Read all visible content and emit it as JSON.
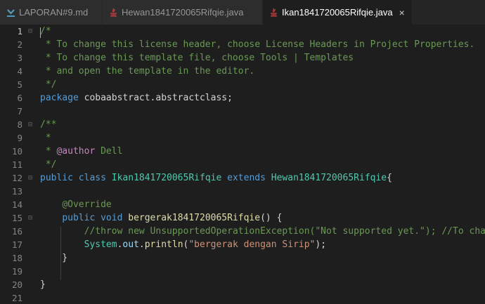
{
  "tabs": [
    {
      "label": "LAPORAN#9.md",
      "icon": "markdown-icon",
      "active": false
    },
    {
      "label": "Hewan1841720065Rifqie.java",
      "icon": "java-icon",
      "active": false
    },
    {
      "label": "Ikan1841720065Rifqie.java",
      "icon": "java-icon",
      "active": true
    }
  ],
  "close_glyph": "×",
  "gutter": {
    "current_line": 1,
    "fold_glyph": "⊟",
    "folds": [
      1,
      8,
      12,
      15
    ]
  },
  "lines": [
    {
      "n": "1",
      "tokens": [
        {
          "t": "/*",
          "c": "cm"
        }
      ]
    },
    {
      "n": "2",
      "tokens": [
        {
          "t": " * To change this license header, choose License Headers in Project Properties.",
          "c": "cm"
        }
      ]
    },
    {
      "n": "3",
      "tokens": [
        {
          "t": " * To change this template file, choose Tools | Templates",
          "c": "cm"
        }
      ]
    },
    {
      "n": "4",
      "tokens": [
        {
          "t": " * and open the template in the editor.",
          "c": "cm"
        }
      ]
    },
    {
      "n": "5",
      "tokens": [
        {
          "t": " */",
          "c": "cm"
        }
      ]
    },
    {
      "n": "6",
      "tokens": [
        {
          "t": "package",
          "c": "kw"
        },
        {
          "t": " cobaabstract.abstractclass;",
          "c": "tx"
        }
      ]
    },
    {
      "n": "7",
      "tokens": []
    },
    {
      "n": "8",
      "tokens": [
        {
          "t": "/**",
          "c": "cm"
        }
      ]
    },
    {
      "n": "9",
      "tokens": [
        {
          "t": " *",
          "c": "cm"
        }
      ]
    },
    {
      "n": "10",
      "tokens": [
        {
          "t": " * ",
          "c": "cm"
        },
        {
          "t": "@author",
          "c": "an"
        },
        {
          "t": " Dell",
          "c": "cm"
        }
      ]
    },
    {
      "n": "11",
      "tokens": [
        {
          "t": " */",
          "c": "cm"
        }
      ]
    },
    {
      "n": "12",
      "tokens": [
        {
          "t": "public",
          "c": "kw"
        },
        {
          "t": " ",
          "c": "tx"
        },
        {
          "t": "class",
          "c": "kw"
        },
        {
          "t": " ",
          "c": "tx"
        },
        {
          "t": "Ikan1841720065Rifqie",
          "c": "ty"
        },
        {
          "t": " ",
          "c": "tx"
        },
        {
          "t": "extends",
          "c": "kw"
        },
        {
          "t": " ",
          "c": "tx"
        },
        {
          "t": "Hewan1841720065Rifqie",
          "c": "ty"
        },
        {
          "t": "{",
          "c": "tx"
        }
      ]
    },
    {
      "n": "13",
      "tokens": []
    },
    {
      "n": "14",
      "tokens": [
        {
          "t": "    ",
          "c": "tx"
        },
        {
          "t": "@Override",
          "c": "cm"
        }
      ]
    },
    {
      "n": "15",
      "tokens": [
        {
          "t": "    ",
          "c": "tx"
        },
        {
          "t": "public",
          "c": "kw"
        },
        {
          "t": " ",
          "c": "tx"
        },
        {
          "t": "void",
          "c": "kw"
        },
        {
          "t": " ",
          "c": "tx"
        },
        {
          "t": "bergerak1841720065Rifqie",
          "c": "fn"
        },
        {
          "t": "() {",
          "c": "tx"
        }
      ]
    },
    {
      "n": "16",
      "tokens": [
        {
          "t": "        ",
          "c": "tx"
        },
        {
          "t": "//throw new UnsupportedOperationException(\"Not supported yet.\"); //To chang",
          "c": "cm"
        }
      ]
    },
    {
      "n": "17",
      "tokens": [
        {
          "t": "        ",
          "c": "tx"
        },
        {
          "t": "System",
          "c": "ty"
        },
        {
          "t": ".",
          "c": "tx"
        },
        {
          "t": "out",
          "c": "vr"
        },
        {
          "t": ".",
          "c": "tx"
        },
        {
          "t": "println",
          "c": "fn"
        },
        {
          "t": "(",
          "c": "tx"
        },
        {
          "t": "\"bergerak dengan Sirip\"",
          "c": "st"
        },
        {
          "t": ");",
          "c": "tx"
        }
      ]
    },
    {
      "n": "18",
      "tokens": [
        {
          "t": "    }",
          "c": "tx"
        }
      ]
    },
    {
      "n": "19",
      "tokens": []
    },
    {
      "n": "20",
      "tokens": [
        {
          "t": "}",
          "c": "tx"
        }
      ]
    },
    {
      "n": "21",
      "tokens": []
    }
  ]
}
